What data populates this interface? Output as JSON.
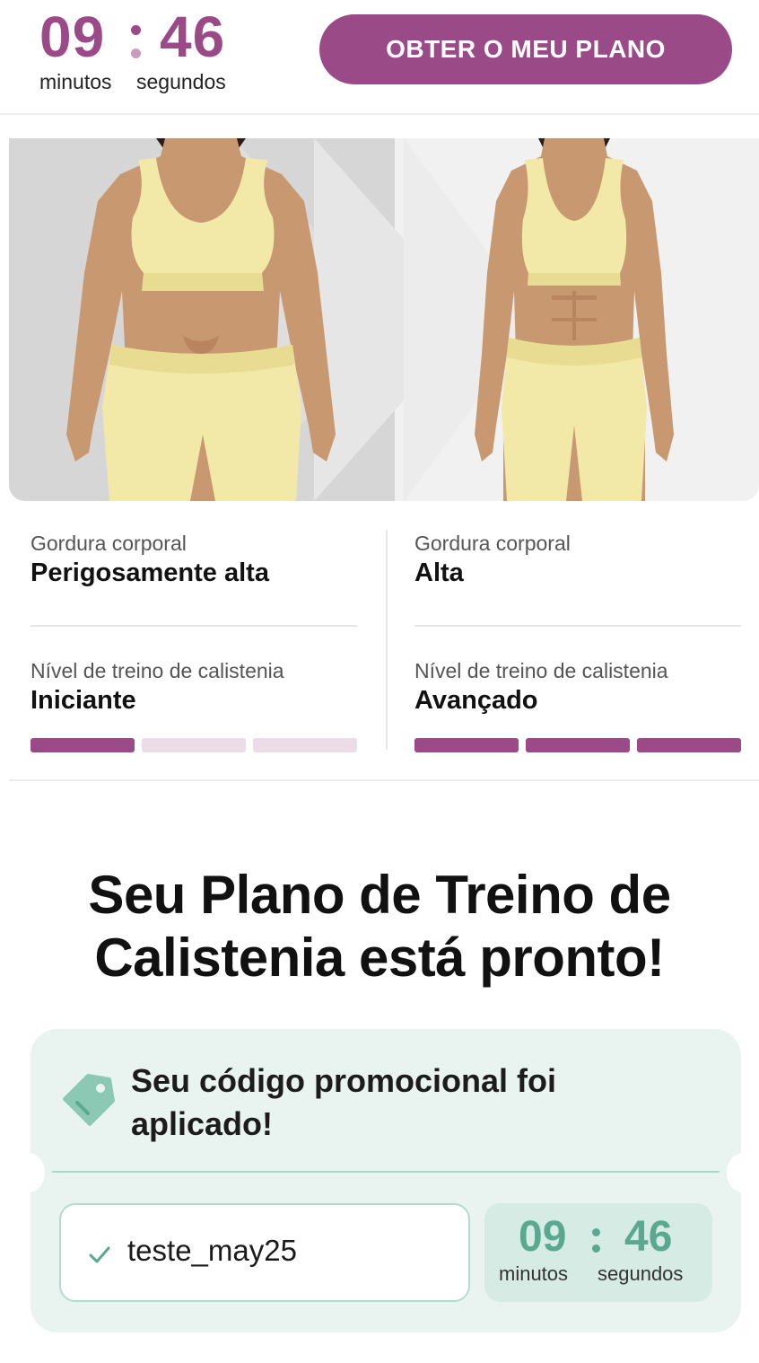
{
  "header": {
    "timer": {
      "minutes": "09",
      "seconds": "46",
      "minutes_label": "minutos",
      "seconds_label": "segundos"
    },
    "cta_label": "OBTER O MEU PLANO"
  },
  "stats": {
    "before": {
      "body_fat_label": "Gordura corporal",
      "body_fat_value": "Perigosamente alta",
      "level_label": "Nível de treino de calistenia",
      "level_value": "Iniciante",
      "level_bars_filled": 1,
      "level_bars_total": 3
    },
    "after": {
      "body_fat_label": "Gordura corporal",
      "body_fat_value": "Alta",
      "level_label": "Nível de treino de calistenia",
      "level_value": "Avançado",
      "level_bars_filled": 3,
      "level_bars_total": 3
    }
  },
  "main": {
    "title_line1": "Seu Plano de Treino de",
    "title_line2": "Calistenia está pronto!"
  },
  "promo": {
    "message_line1": "Seu código promocional foi",
    "message_line2": "aplicado!",
    "code": "teste_may25",
    "timer": {
      "minutes": "09",
      "seconds": "46",
      "minutes_label": "minutos",
      "seconds_label": "segundos"
    }
  },
  "colors": {
    "brand": "#9b4a88",
    "brand_light": "#ecdce8",
    "promo_bg": "#e9f4f0",
    "promo_accent": "#5ba891"
  },
  "icons": {
    "promo_tag": "tag-icon",
    "code_check": "check-icon"
  }
}
